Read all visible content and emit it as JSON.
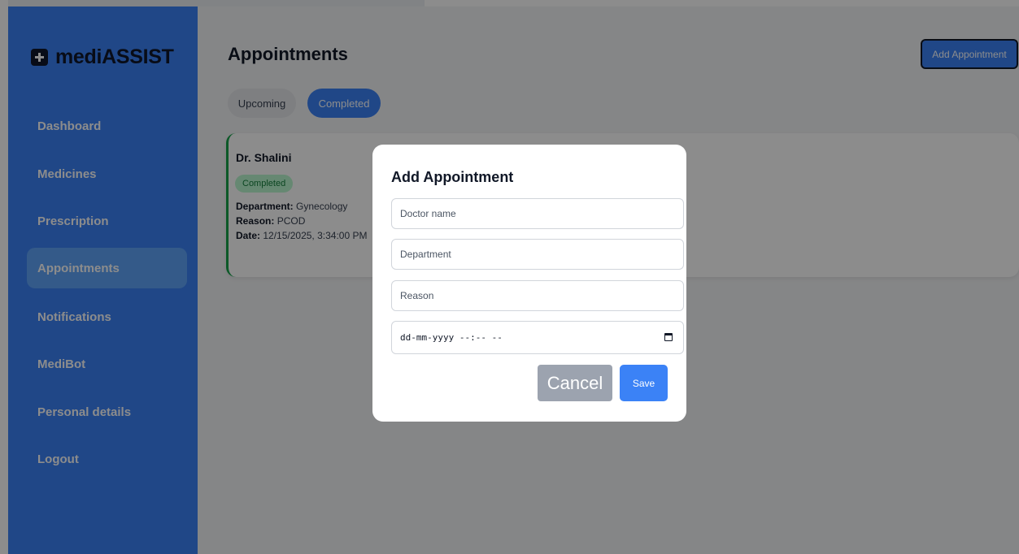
{
  "brand": {
    "name": "mediASSIST",
    "icon": "plus-square-icon"
  },
  "sidebar": {
    "items": [
      {
        "label": "Dashboard"
      },
      {
        "label": "Medicines"
      },
      {
        "label": "Prescription"
      },
      {
        "label": "Appointments",
        "active": true
      },
      {
        "label": "Notifications"
      },
      {
        "label": "MediBot"
      },
      {
        "label": "Personal details"
      },
      {
        "label": "Logout"
      }
    ]
  },
  "main": {
    "title": "Appointments",
    "add_button": "Add Appointment",
    "tabs": [
      {
        "label": "Upcoming"
      },
      {
        "label": "Completed",
        "selected": true
      }
    ],
    "appointment": {
      "doctor": "Dr. Shalini",
      "status": "Completed",
      "department_label": "Department:",
      "department": "Gynecology",
      "reason_label": "Reason:",
      "reason": "PCOD",
      "date_label": "Date:",
      "date": "12/15/2025, 3:34:00 PM"
    }
  },
  "modal": {
    "title": "Add Appointment",
    "doctor_placeholder": "Doctor name",
    "department_placeholder": "Department",
    "reason_placeholder": "Reason",
    "date_placeholder": "dd-mm-yyyy --:-- --",
    "cancel_label": "Cancel",
    "save_label": "Save"
  },
  "colors": {
    "sidebar": "#3b82f6",
    "active_nav": "#60a5fa",
    "accent": "#3b82f6",
    "completed_border": "#16a34a",
    "cancel": "#9ca3af"
  }
}
